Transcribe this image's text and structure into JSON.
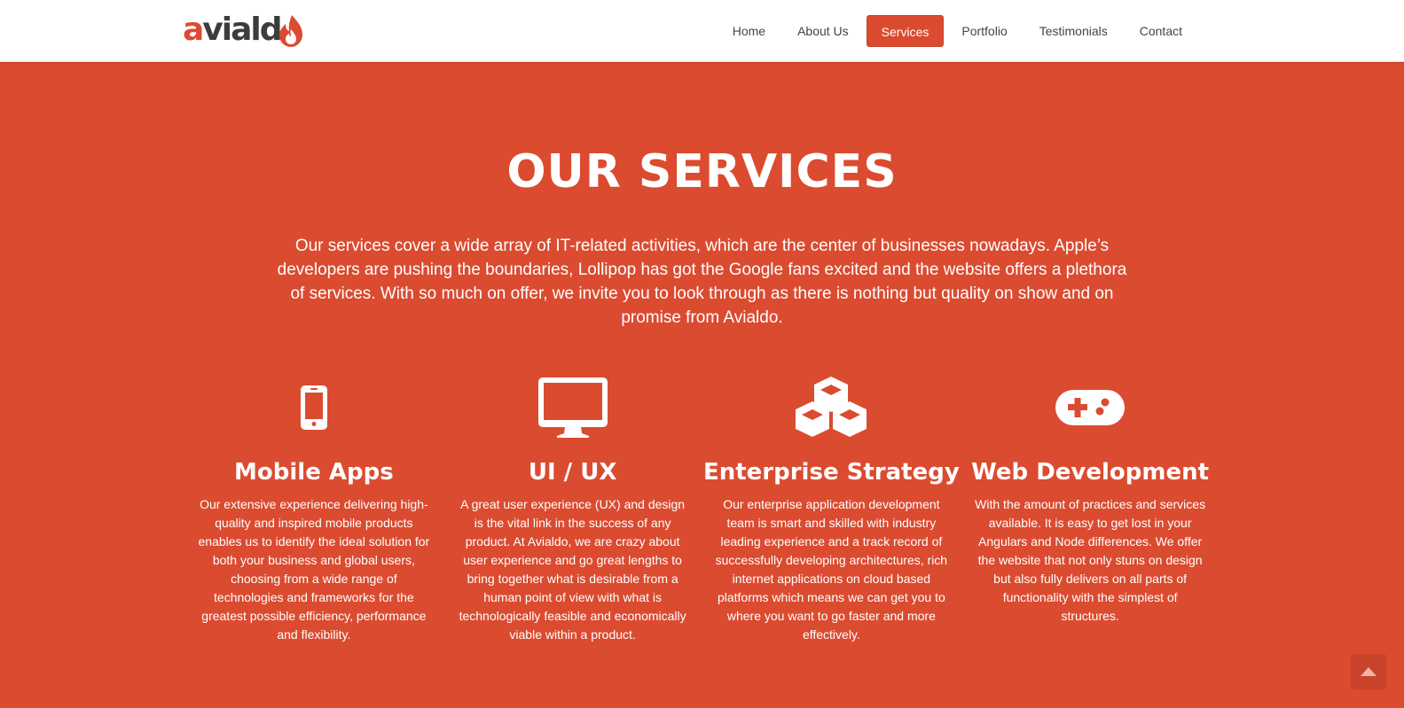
{
  "brand": {
    "name_a": "a",
    "name_rest": "viald"
  },
  "nav": [
    {
      "label": "Home",
      "active": false
    },
    {
      "label": "About Us",
      "active": false
    },
    {
      "label": "Services",
      "active": true
    },
    {
      "label": "Portfolio",
      "active": false
    },
    {
      "label": "Testimonials",
      "active": false
    },
    {
      "label": "Contact",
      "active": false
    }
  ],
  "section": {
    "title": "OUR SERVICES",
    "intro": "Our services cover a wide array of IT-related activities, which are the center of businesses nowadays. Apple’s developers are pushing the boundaries, Lollipop has got the Google fans excited and the website offers a plethora of services. With so much on offer, we invite you to look through as there is nothing but quality on show and on promise from Avialdo."
  },
  "services": [
    {
      "icon": "mobile-phone-icon",
      "title": "Mobile Apps",
      "desc": "Our extensive experience delivering high-quality and inspired mobile products enables us to identify the ideal solution for both your business and global users, choosing from a wide range of technologies and frameworks for the greatest possible efficiency, performance and flexibility."
    },
    {
      "icon": "desktop-monitor-icon",
      "title": "UI / UX",
      "desc": "A great user experience (UX) and design is the vital link in the success of any product. At Avialdo, we are crazy about user experience and go great lengths to bring together what is desirable from a human point of view with what is technologically feasible and economically viable within a product."
    },
    {
      "icon": "cubes-icon",
      "title": "Enterprise Strategy",
      "desc": "Our enterprise application development team is smart and skilled with industry leading experience and a track record of successfully developing architectures, rich internet applications on cloud based platforms which means we can get you to where you want to go faster and more effectively."
    },
    {
      "icon": "gamepad-icon",
      "title": "Web Development",
      "desc": "With the amount of practices and services available. It is easy to get lost in your Angulars and Node differences. We offer the website that not only stuns on design but also fully delivers on all parts of functionality with the simplest of structures."
    }
  ],
  "colors": {
    "accent": "#db4b30",
    "nav_text": "#444444",
    "logo_dark": "#3c3c3c"
  }
}
